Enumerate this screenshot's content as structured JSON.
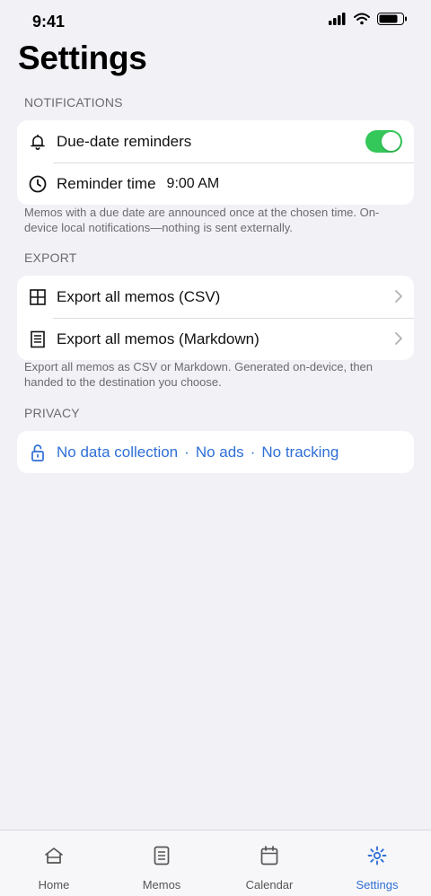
{
  "status_bar": {
    "time": "9:41"
  },
  "title": "Settings",
  "notifications": {
    "header": "NOTIFICATIONS",
    "due_date_label": "Due-date reminders",
    "due_date_enabled": true,
    "reminder_time_label": "Reminder time",
    "reminder_time_value": "9:00 AM",
    "footnote": "Memos with a due date are announced once at the chosen time. On-device local notifications—nothing is sent externally."
  },
  "export": {
    "header": "EXPORT",
    "csv_label": "Export all memos (CSV)",
    "markdown_label": "Export all memos (Markdown)",
    "footnote": "Export all memos as CSV or Markdown. Generated on-device, then handed to the destination you choose."
  },
  "privacy": {
    "header": "PRIVACY",
    "items": [
      "No data collection",
      "No ads",
      "No tracking"
    ],
    "separator": "·"
  },
  "tabs": [
    {
      "label": "Home",
      "icon": "home-icon",
      "active": false
    },
    {
      "label": "Memos",
      "icon": "memos-icon",
      "active": false
    },
    {
      "label": "Calendar",
      "icon": "calendar-icon",
      "active": false
    },
    {
      "label": "Settings",
      "icon": "settings-icon",
      "active": true
    }
  ],
  "colors": {
    "background": "#f2f1f6",
    "accent": "#2f6fd6",
    "toggle_on": "#34c759"
  }
}
